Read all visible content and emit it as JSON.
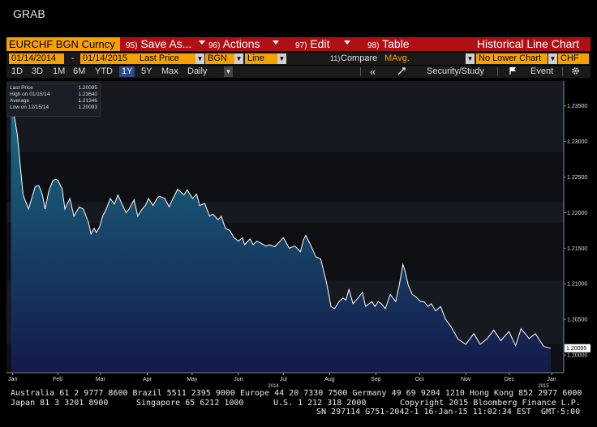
{
  "app": {
    "title": "GRAB"
  },
  "toolbar": {
    "ticker": "EURCHF BGN Curncy",
    "save": {
      "num": "95)",
      "label": "Save As..."
    },
    "actions": {
      "num": "96)",
      "label": "Actions"
    },
    "edit": {
      "num": "97)",
      "label": "Edit"
    },
    "table": {
      "num": "98)",
      "label": "Table"
    },
    "chart_title": "Historical Line Chart"
  },
  "params": {
    "start_date": "01/14/2014",
    "dash": "-",
    "end_date": "01/14/2015",
    "field": "Last Price",
    "source": "BGN",
    "style": "Line",
    "compare_num": "11)",
    "compare": "Compare",
    "mavg": "MAvg.",
    "lower": "No Lower Chart",
    "currency": "CHF"
  },
  "periods": [
    "1D",
    "3D",
    "1M",
    "6M",
    "YTD",
    "1Y",
    "5Y",
    "Max"
  ],
  "active_period": "1Y",
  "frequency": "Daily",
  "rightbar": {
    "back": "«",
    "security": "Security/Study",
    "event": "Event"
  },
  "legend": {
    "rows": [
      {
        "label": "Last Price",
        "value": "1.20095"
      },
      {
        "label": "High on 01/15/14",
        "value": "1.23640"
      },
      {
        "label": "Average",
        "value": "1.21346"
      },
      {
        "label": "Low on 12/15/14",
        "value": "1.20093"
      }
    ]
  },
  "footer": {
    "line1": "Australia 61 2 9777 8600 Brazil 5511 2395 9000 Europe 44 20 7330 7500 Germany 49 69 9204 1210 Hong Kong 852 2977 6000",
    "line2a": "Japan 81 3 3201 8900",
    "line2b": "Singapore 65 6212 1000",
    "line2c": "U.S. 1 212 318 2000",
    "line2d": "Copyright 2015 Bloomberg Finance L.P.",
    "line3": "SN 297114 G751-2042-1 16-Jan-15 11:02:34 EST  GMT-5:00"
  },
  "colors": {
    "accent_orange": "#f5a100",
    "toolbar_red": "#b00f14",
    "line": "#ffffff",
    "fill_top": "#1a6f86",
    "fill_bottom": "#141a4a"
  },
  "chart_data": {
    "type": "area",
    "y_ticks": [
      "1.23500",
      "1.23000",
      "1.22500",
      "1.22000",
      "1.21500",
      "1.21000",
      "1.20500",
      "1.20000"
    ],
    "y_tick_values": [
      1.235,
      1.23,
      1.225,
      1.22,
      1.215,
      1.21,
      1.205,
      1.2
    ],
    "ylim": [
      1.1975,
      1.2385
    ],
    "x_ticks": [
      {
        "label": "Jan",
        "t": 0.04
      },
      {
        "label": "Feb",
        "t": 1.04
      },
      {
        "label": "Mar",
        "t": 1.99
      },
      {
        "label": "Apr",
        "t": 3.03
      },
      {
        "label": "May",
        "t": 4.03
      },
      {
        "label": "Jun",
        "t": 5.06
      },
      {
        "label": "Jul",
        "t": 6.06
      },
      {
        "label": "Aug",
        "t": 7.09
      },
      {
        "label": "Sep",
        "t": 8.12
      },
      {
        "label": "Oct",
        "t": 9.09
      },
      {
        "label": "Nov",
        "t": 10.12
      },
      {
        "label": "Dec",
        "t": 11.09
      },
      {
        "label": "Jan",
        "t": 12.03
      }
    ],
    "year_labels": [
      {
        "label": "2014",
        "t": 5.84
      },
      {
        "label": "2015",
        "t": 11.85
      }
    ],
    "last_value_label": "1.20095",
    "series": [
      {
        "name": "Last Price",
        "t": [
          0.0,
          0.14,
          0.27,
          0.39,
          0.54,
          0.62,
          0.7,
          0.76,
          0.84,
          0.93,
          1.0,
          1.05,
          1.14,
          1.2,
          1.31,
          1.4,
          1.52,
          1.61,
          1.73,
          1.78,
          1.85,
          1.9,
          1.97,
          2.04,
          2.12,
          2.21,
          2.3,
          2.38,
          2.47,
          2.56,
          2.63,
          2.74,
          2.82,
          2.92,
          2.99,
          3.06,
          3.16,
          3.25,
          3.3,
          3.42,
          3.52,
          3.59,
          3.71,
          3.76,
          3.85,
          3.92,
          4.04,
          4.13,
          4.2,
          4.31,
          4.42,
          4.49,
          4.61,
          4.68,
          4.77,
          4.87,
          4.96,
          5.06,
          5.15,
          5.2,
          5.32,
          5.39,
          5.47,
          5.56,
          5.68,
          5.75,
          5.87,
          5.96,
          6.06,
          6.19,
          6.32,
          6.44,
          6.51,
          6.56,
          6.68,
          6.78,
          6.89,
          7.01,
          7.08,
          7.12,
          7.2,
          7.3,
          7.39,
          7.45,
          7.52,
          7.61,
          7.72,
          7.82,
          7.89,
          8.03,
          8.1,
          8.17,
          8.24,
          8.33,
          8.44,
          8.56,
          8.63,
          8.72,
          8.77,
          8.84,
          8.93,
          9.0,
          9.12,
          9.19,
          9.28,
          9.35,
          9.45,
          9.56,
          9.67,
          9.79,
          9.95,
          10.12,
          10.3,
          10.44,
          10.6,
          10.74,
          10.9,
          11.08,
          11.23,
          11.35,
          11.53,
          11.67,
          11.85,
          12.01
        ],
        "values": [
          1.2364,
          1.231,
          1.2225,
          1.2205,
          1.2237,
          1.2238,
          1.2225,
          1.2205,
          1.223,
          1.2245,
          1.2247,
          1.2245,
          1.2233,
          1.2205,
          1.222,
          1.2195,
          1.2208,
          1.2205,
          1.2185,
          1.217,
          1.2178,
          1.2172,
          1.218,
          1.2195,
          1.2205,
          1.222,
          1.2212,
          1.2225,
          1.2212,
          1.22,
          1.2205,
          1.2218,
          1.2195,
          1.2205,
          1.221,
          1.222,
          1.221,
          1.222,
          1.2223,
          1.222,
          1.2208,
          1.2218,
          1.2233,
          1.223,
          1.2225,
          1.2232,
          1.222,
          1.2226,
          1.221,
          1.2213,
          1.2195,
          1.2198,
          1.219,
          1.2195,
          1.2178,
          1.2175,
          1.2165,
          1.216,
          1.2165,
          1.2155,
          1.2163,
          1.2155,
          1.216,
          1.2157,
          1.2153,
          1.2155,
          1.2152,
          1.2158,
          1.2165,
          1.215,
          1.2153,
          1.2145,
          1.2162,
          1.2168,
          1.2153,
          1.2138,
          1.2135,
          1.2105,
          1.2082,
          1.2068,
          1.2065,
          1.2075,
          1.208,
          1.2077,
          1.2092,
          1.2072,
          1.208,
          1.2088,
          1.2068,
          1.2075,
          1.2068,
          1.2075,
          1.2072,
          1.2065,
          1.2085,
          1.2075,
          1.2095,
          1.2127,
          1.2118,
          1.2098,
          1.2085,
          1.2082,
          1.2075,
          1.2075,
          1.2068,
          1.2072,
          1.2062,
          1.2068,
          1.205,
          1.204,
          1.2022,
          1.2015,
          1.203,
          1.2015,
          1.2023,
          1.2035,
          1.202,
          1.2033,
          1.2013,
          1.2037,
          1.2023,
          1.203,
          1.2012,
          1.20095
        ]
      }
    ],
    "bands": [
      {
        "from": 1.2385,
        "to": 1.2285,
        "color": "#161a20"
      },
      {
        "from": 1.2285,
        "to": 1.2215,
        "color": "#0d0f12"
      },
      {
        "from": 1.2215,
        "to": 1.2185,
        "color": "#161a20"
      },
      {
        "from": 1.2185,
        "to": 1.2105,
        "color": "#0d0f12"
      },
      {
        "from": 1.2105,
        "to": 1.2015,
        "color": "#161a20"
      },
      {
        "from": 1.2015,
        "to": 1.1975,
        "color": "#0d0f12"
      }
    ],
    "t_range": [
      -0.1,
      12.3
    ],
    "grid": false
  }
}
